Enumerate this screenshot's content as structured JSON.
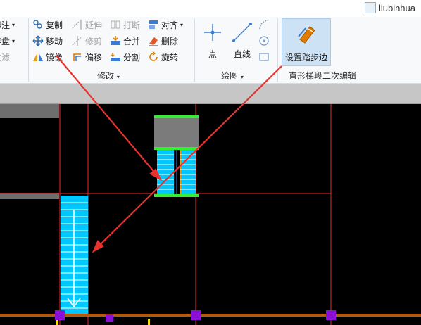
{
  "user": {
    "name": "liubinhua"
  },
  "left_cut": {
    "items": [
      "标注",
      "存盘",
      "过滤"
    ]
  },
  "modify": {
    "group_label": "修改",
    "items": {
      "copy": "复制",
      "extend": "延伸",
      "break": "打断",
      "align": "对齐",
      "move": "移动",
      "trim": "修剪",
      "merge": "合并",
      "delete": "删除",
      "mirror": "镜像",
      "offset": "偏移",
      "split": "分割",
      "rotate": "旋转"
    }
  },
  "draw": {
    "group_label": "绘图",
    "point": "点",
    "line": "直线"
  },
  "stair": {
    "set_edge": "设置踏步边",
    "group_label": "直形梯段二次编辑"
  },
  "colors": {
    "arrow": "#e8322e",
    "stair_fill": "#00c8ff",
    "grid_line": "#cc2222",
    "green_edge": "#33ee33"
  }
}
